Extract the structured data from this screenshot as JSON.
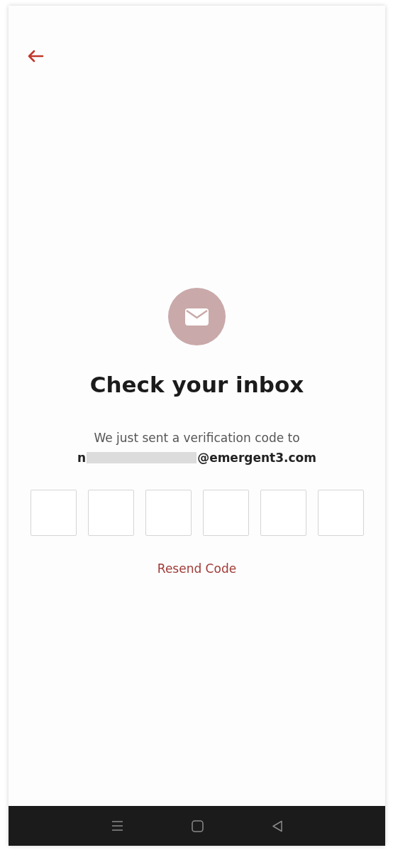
{
  "back_button": {
    "kind": "arrow"
  },
  "title": "Check your inbox",
  "message": "We just sent a verification code to",
  "email": {
    "start": "n",
    "redacted": true,
    "end": "@emergent3.com"
  },
  "code_boxes": [
    {
      "kind": "digit"
    },
    {
      "kind": "digit"
    },
    {
      "kind": "digit"
    },
    {
      "kind": "digit"
    },
    {
      "kind": "digit"
    },
    {
      "kind": "digit"
    }
  ],
  "resend": "Resend Code",
  "nav_bar": [
    {
      "kind": "menu"
    },
    {
      "kind": "home"
    },
    {
      "kind": "back"
    }
  ]
}
